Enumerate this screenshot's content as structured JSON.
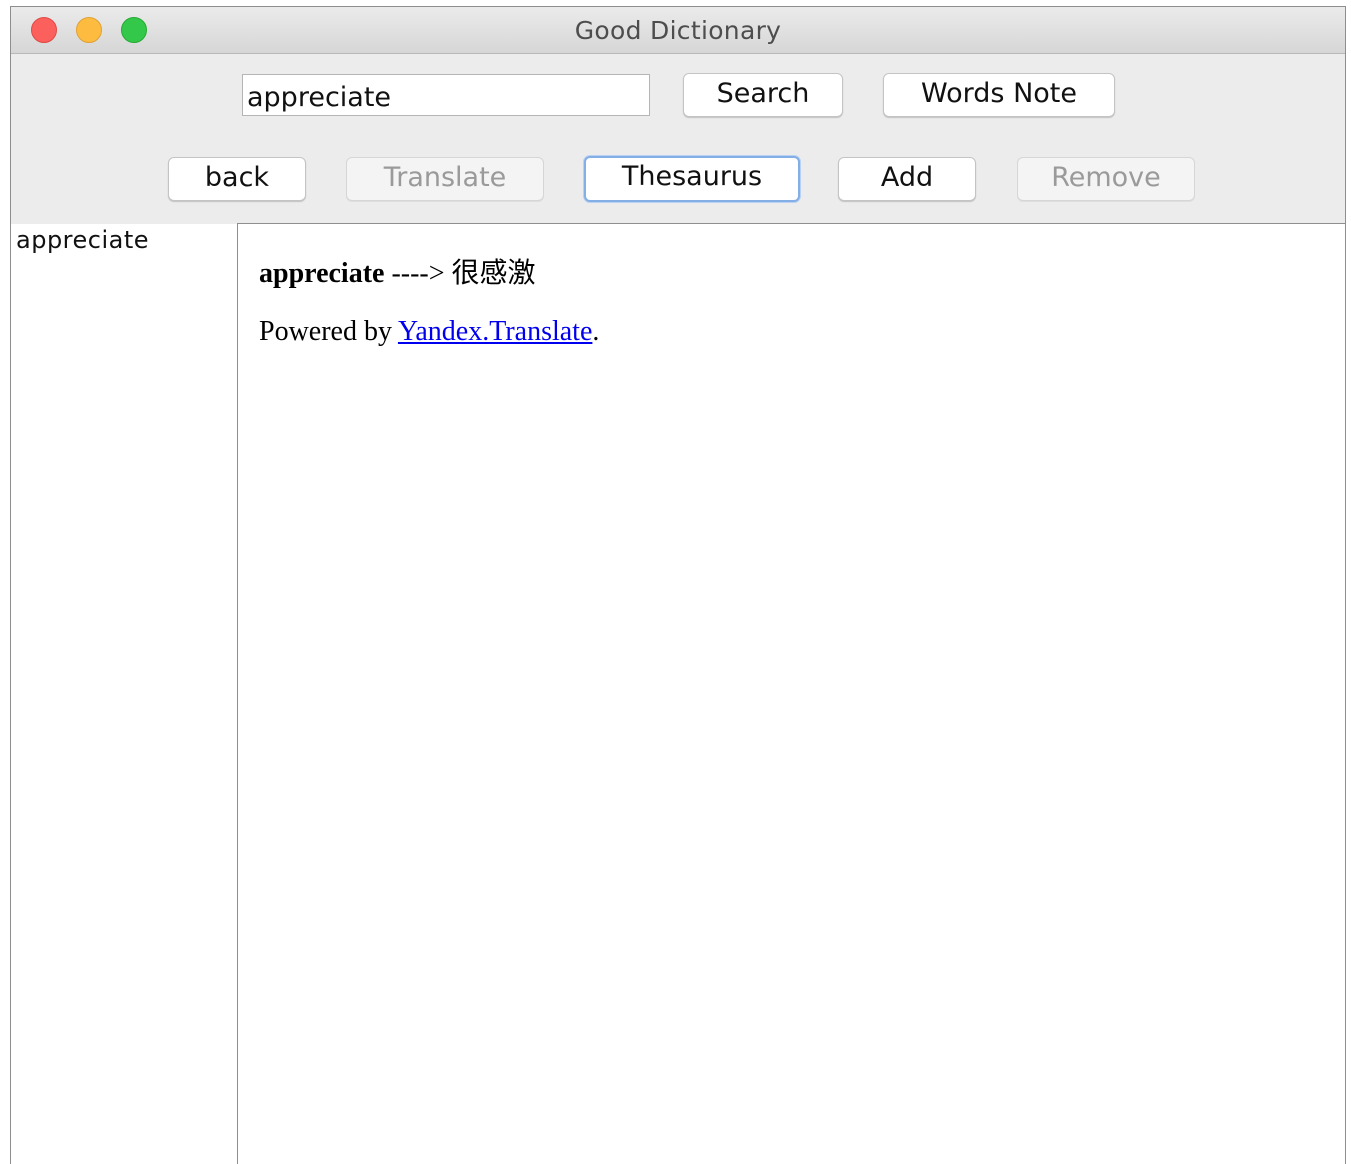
{
  "window": {
    "title": "Good Dictionary"
  },
  "toolbar": {
    "search_value": "appreciate",
    "search_label": "Search",
    "words_note_label": "Words Note",
    "back_label": "back",
    "translate_label": "Translate",
    "thesaurus_label": "Thesaurus",
    "add_label": "Add",
    "remove_label": "Remove"
  },
  "word_list": {
    "items": [
      {
        "label": "appreciate"
      }
    ]
  },
  "result": {
    "word": "appreciate",
    "arrow": " ----> ",
    "translation": "很感激",
    "powered_by": "Powered by ",
    "provider_link": "Yandex.Translate",
    "period": "."
  },
  "colors": {
    "close": "#fc605c",
    "minimize": "#fdbc40",
    "maximize": "#34c84a",
    "link": "#0000ee",
    "focus_ring": "#84aee6"
  }
}
